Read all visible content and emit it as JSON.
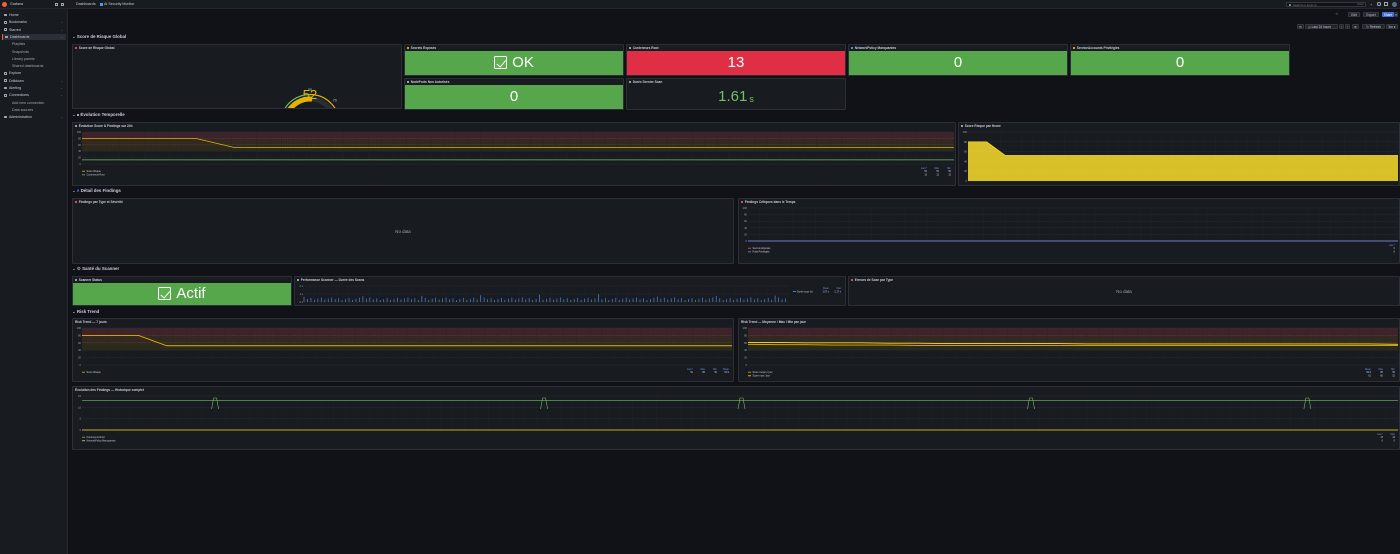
{
  "app": {
    "title": "Grafana",
    "breadcrumb_home": "Dashboards",
    "dashboard_title": "AI Security Monitor"
  },
  "topbar": {
    "search_placeholder": "Search or jump to",
    "shortcut": "ctrl+k",
    "edit_label": "Edit",
    "export_label": "Export",
    "share_label": "Share",
    "time_range": "Last 24 hours",
    "refresh_label": "Refresh",
    "refresh_interval": "5m"
  },
  "sidebar": {
    "items": [
      {
        "label": "Home",
        "type": "item"
      },
      {
        "label": "Bookmarks",
        "type": "item"
      },
      {
        "label": "Starred",
        "type": "item"
      },
      {
        "label": "Dashboards",
        "type": "item",
        "active": true
      },
      {
        "label": "Playlists",
        "type": "sub"
      },
      {
        "label": "Snapshots",
        "type": "sub"
      },
      {
        "label": "Library panels",
        "type": "sub"
      },
      {
        "label": "Shared dashboards",
        "type": "sub"
      },
      {
        "label": "Explore",
        "type": "item"
      },
      {
        "label": "Drilldown",
        "type": "item"
      },
      {
        "label": "Alerting",
        "type": "item"
      },
      {
        "label": "Connections",
        "type": "item"
      },
      {
        "label": "Add new connection",
        "type": "sub"
      },
      {
        "label": "Data sources",
        "type": "sub"
      },
      {
        "label": "Administration",
        "type": "item"
      }
    ]
  },
  "rows": {
    "r1": "Score de Risque Global",
    "r2": "Évolution Temporelle",
    "r3": "Détail des Findings",
    "r4": "Santé du Scanner",
    "r5": "Risk Trend"
  },
  "panels": {
    "gauge": {
      "title": "Score de Risque Global",
      "value": "52",
      "ticks": [
        "50",
        "70",
        "90"
      ]
    },
    "secrets": {
      "title": "Secrets Exposés",
      "value": "OK"
    },
    "containers": {
      "title": "Conteneurs Root",
      "value": "13"
    },
    "netpol": {
      "title": "NetworkPolicy Manquantes",
      "value": "0"
    },
    "serviceaccounts": {
      "title": "ServiceAccounts Privilégiés",
      "value": "0"
    },
    "nodeports": {
      "title": "NodePorts Non Autorisés",
      "value": "0"
    },
    "duration": {
      "title": "Durée Dernier Scan",
      "value": "1.61",
      "unit": "s"
    },
    "evolution": {
      "title": "Évolution Score & Findings sur 24h",
      "legend_headers": [
        "Last *",
        "Max",
        "Min"
      ],
      "legend": [
        {
          "name": "Score Risque",
          "color": "#e0b400",
          "vals": [
            "52",
            "52",
            "50"
          ]
        },
        {
          "name": "Conteneurs Root",
          "color": "#73bf69",
          "vals": [
            "13",
            "13",
            "13"
          ]
        }
      ]
    },
    "score_hour": {
      "title": "Score Risque par Heure"
    },
    "findings_type": {
      "title": "Findings par Type et Sévérité",
      "nodata": "No data"
    },
    "critical_time": {
      "title": "Findings Critiques dans le Temps",
      "legend_headers": [
        "Last *"
      ],
      "legend": [
        {
          "name": "Secrets Exposés",
          "color": "#f2495c",
          "vals": [
            "0"
          ]
        },
        {
          "name": "Pods Privilégiés",
          "color": "#5794f2",
          "vals": [
            "0"
          ]
        }
      ]
    },
    "scanner_status": {
      "title": "Scanner Status",
      "value": "Actif"
    },
    "scan_perf": {
      "title": "Performance Scanner — Durée des Scans",
      "legend_headers": [
        "Mean",
        "Max"
      ],
      "legend": [
        {
          "name": "Durée scan (s)",
          "color": "#5794f2",
          "vals": [
            "1.07 s",
            "2.17 s"
          ]
        }
      ]
    },
    "errors_type": {
      "title": "Erreurs de Scan par Type",
      "nodata": "No data"
    },
    "risk7": {
      "title": "Risk Trend — 7 jours",
      "legend_headers": [
        "Last *",
        "Max",
        "Min",
        "Mean"
      ],
      "legend": [
        {
          "name": "Score Risque",
          "color": "#e0b400",
          "vals": [
            "52",
            "80",
            "50",
            "52.9"
          ]
        }
      ]
    },
    "risk_avg": {
      "title": "Risk Trend — Moyenne / Max / Min par jour",
      "legend_headers": [
        "Mean",
        "Max",
        "Min"
      ],
      "legend": [
        {
          "name": "Score moyen / jour",
          "color": "#e0b400",
          "vals": [
            "52.9",
            "80",
            "50"
          ]
        },
        {
          "name": "Score max / jour",
          "color": "#fade2a",
          "vals": [
            "61",
            "80",
            "52"
          ]
        }
      ]
    },
    "findings_hist": {
      "title": "Évolution des Findings — Historique complet",
      "legend_headers": [
        "Last *",
        "Max"
      ],
      "legend": [
        {
          "name": "Conteneurs Root",
          "color": "#73bf69",
          "vals": [
            "13",
            "13"
          ]
        },
        {
          "name": "NetworkPolicy Manquantes",
          "color": "#fade2a",
          "vals": [
            "0",
            "0"
          ]
        }
      ]
    }
  },
  "axes": {
    "y5": [
      "100",
      "80",
      "60",
      "40",
      "20",
      "0"
    ],
    "perf_y": [
      "2 s",
      "1 s",
      "0 s"
    ]
  },
  "chart_data": [
    {
      "type": "line",
      "title": "Évolution Score & Findings sur 24h",
      "ylim": [
        0,
        100
      ],
      "series": [
        {
          "name": "Score Risque",
          "values": [
            80,
            80,
            80,
            80,
            52,
            52,
            52,
            52,
            52,
            52,
            52,
            52,
            52,
            52,
            52,
            52,
            52,
            52,
            52,
            52,
            52,
            52,
            52,
            52
          ]
        },
        {
          "name": "Conteneurs Root",
          "values": [
            13,
            13,
            13,
            13,
            13,
            13,
            13,
            13,
            13,
            13,
            13,
            13,
            13,
            13,
            13,
            13,
            13,
            13,
            13,
            13,
            13,
            13,
            13,
            13
          ]
        }
      ]
    },
    {
      "type": "area",
      "title": "Score Risque par Heure",
      "ylim": [
        0,
        100
      ],
      "series": [
        {
          "name": "Score Risque",
          "values": [
            80,
            80,
            52,
            52,
            52,
            52,
            52,
            52,
            52,
            52,
            52,
            52,
            52,
            52,
            52,
            52,
            52,
            52,
            52,
            52,
            52,
            52,
            52,
            52
          ]
        }
      ]
    },
    {
      "type": "line",
      "title": "Risk Trend — 7 jours",
      "ylim": [
        0,
        100
      ],
      "series": [
        {
          "name": "Score Risque",
          "values": [
            80,
            80,
            80,
            52,
            52,
            52,
            52,
            52,
            52,
            52,
            52,
            52,
            52,
            52,
            52,
            52,
            52,
            52,
            52,
            52,
            52,
            52,
            52,
            52
          ]
        }
      ]
    }
  ]
}
